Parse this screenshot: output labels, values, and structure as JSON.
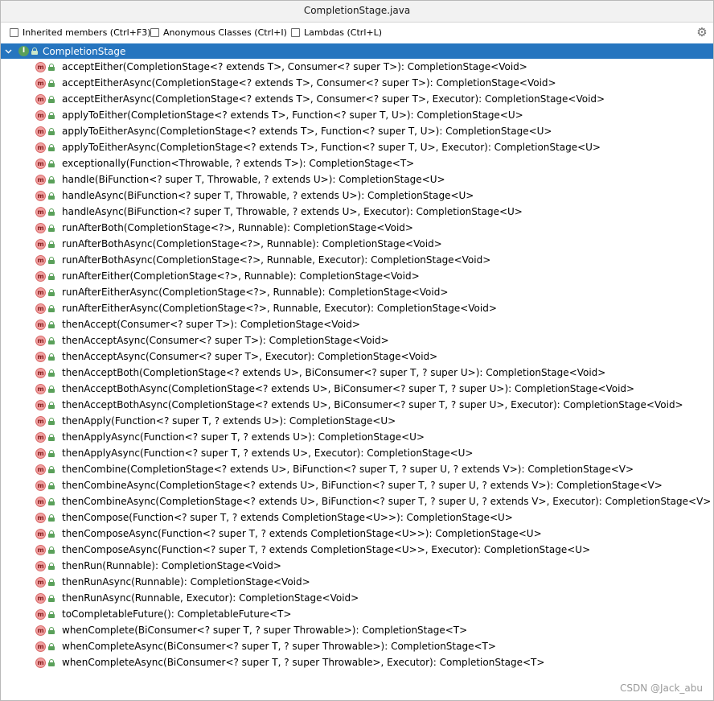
{
  "window": {
    "title": "CompletionStage.java"
  },
  "options": [
    {
      "label": "Inherited members (Ctrl+F3)",
      "checked": false
    },
    {
      "label": "Anonymous Classes (Ctrl+I)",
      "checked": false
    },
    {
      "label": "Lambdas (Ctrl+L)",
      "checked": false
    }
  ],
  "tree": {
    "root": {
      "label": "CompletionStage",
      "icon": "interface-icon"
    },
    "methods": [
      "acceptEither(CompletionStage<? extends T>, Consumer<? super T>): CompletionStage<Void>",
      "acceptEitherAsync(CompletionStage<? extends T>, Consumer<? super T>): CompletionStage<Void>",
      "acceptEitherAsync(CompletionStage<? extends T>, Consumer<? super T>, Executor): CompletionStage<Void>",
      "applyToEither(CompletionStage<? extends T>, Function<? super T, U>): CompletionStage<U>",
      "applyToEitherAsync(CompletionStage<? extends T>, Function<? super T, U>): CompletionStage<U>",
      "applyToEitherAsync(CompletionStage<? extends T>, Function<? super T, U>, Executor): CompletionStage<U>",
      "exceptionally(Function<Throwable, ? extends T>): CompletionStage<T>",
      "handle(BiFunction<? super T, Throwable, ? extends U>): CompletionStage<U>",
      "handleAsync(BiFunction<? super T, Throwable, ? extends U>): CompletionStage<U>",
      "handleAsync(BiFunction<? super T, Throwable, ? extends U>, Executor): CompletionStage<U>",
      "runAfterBoth(CompletionStage<?>, Runnable): CompletionStage<Void>",
      "runAfterBothAsync(CompletionStage<?>, Runnable): CompletionStage<Void>",
      "runAfterBothAsync(CompletionStage<?>, Runnable, Executor): CompletionStage<Void>",
      "runAfterEither(CompletionStage<?>, Runnable): CompletionStage<Void>",
      "runAfterEitherAsync(CompletionStage<?>, Runnable): CompletionStage<Void>",
      "runAfterEitherAsync(CompletionStage<?>, Runnable, Executor): CompletionStage<Void>",
      "thenAccept(Consumer<? super T>): CompletionStage<Void>",
      "thenAcceptAsync(Consumer<? super T>): CompletionStage<Void>",
      "thenAcceptAsync(Consumer<? super T>, Executor): CompletionStage<Void>",
      "thenAcceptBoth(CompletionStage<? extends U>, BiConsumer<? super T, ? super U>): CompletionStage<Void>",
      "thenAcceptBothAsync(CompletionStage<? extends U>, BiConsumer<? super T, ? super U>): CompletionStage<Void>",
      "thenAcceptBothAsync(CompletionStage<? extends U>, BiConsumer<? super T, ? super U>, Executor): CompletionStage<Void>",
      "thenApply(Function<? super T, ? extends U>): CompletionStage<U>",
      "thenApplyAsync(Function<? super T, ? extends U>): CompletionStage<U>",
      "thenApplyAsync(Function<? super T, ? extends U>, Executor): CompletionStage<U>",
      "thenCombine(CompletionStage<? extends U>, BiFunction<? super T, ? super U, ? extends V>): CompletionStage<V>",
      "thenCombineAsync(CompletionStage<? extends U>, BiFunction<? super T, ? super U, ? extends V>): CompletionStage<V>",
      "thenCombineAsync(CompletionStage<? extends U>, BiFunction<? super T, ? super U, ? extends V>, Executor): CompletionStage<V>",
      "thenCompose(Function<? super T, ? extends CompletionStage<U>>): CompletionStage<U>",
      "thenComposeAsync(Function<? super T, ? extends CompletionStage<U>>): CompletionStage<U>",
      "thenComposeAsync(Function<? super T, ? extends CompletionStage<U>>, Executor): CompletionStage<U>",
      "thenRun(Runnable): CompletionStage<Void>",
      "thenRunAsync(Runnable): CompletionStage<Void>",
      "thenRunAsync(Runnable, Executor): CompletionStage<Void>",
      "toCompletableFuture(): CompletableFuture<T>",
      "whenComplete(BiConsumer<? super T, ? super Throwable>): CompletionStage<T>",
      "whenCompleteAsync(BiConsumer<? super T, ? super Throwable>): CompletionStage<T>",
      "whenCompleteAsync(BiConsumer<? super T, ? super Throwable>, Executor): CompletionStage<T>"
    ]
  },
  "watermark": "CSDN @Jack_abu",
  "colors": {
    "selection": "#2675bf",
    "method_icon": "#f0a2a2",
    "interface_icon": "#5aa05a"
  }
}
